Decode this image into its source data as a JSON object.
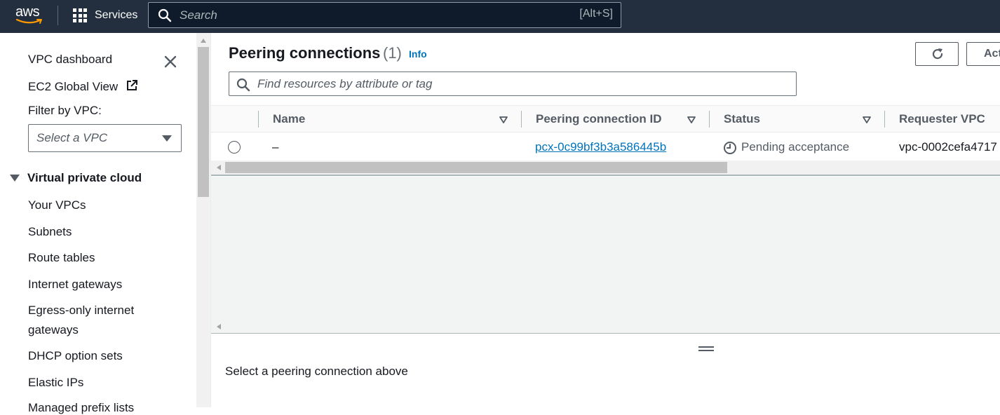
{
  "topnav": {
    "logo_text": "aws",
    "services_label": "Services",
    "search_placeholder": "Search",
    "search_shortcut": "[Alt+S]"
  },
  "sidebar": {
    "dashboard": "VPC dashboard",
    "ec2_global_view": "EC2 Global View",
    "filter_label": "Filter by VPC:",
    "vpc_select_placeholder": "Select a VPC",
    "section_title": "Virtual private cloud",
    "items": [
      "Your VPCs",
      "Subnets",
      "Route tables",
      "Internet gateways",
      "Egress-only internet",
      "gateways",
      "DHCP option sets",
      "Elastic IPs",
      "Managed prefix lists"
    ]
  },
  "main": {
    "title": "Peering connections",
    "count": "(1)",
    "info_label": "Info",
    "actions_label": "Act",
    "filter_placeholder": "Find resources by attribute or tag",
    "columns": [
      "Name",
      "Peering connection ID",
      "Status",
      "Requester VPC"
    ],
    "rows": [
      {
        "name": "–",
        "peering_id": "pcx-0c99bf3b3a586445b",
        "status": "Pending acceptance",
        "requester_vpc": "vpc-0002cefa4717"
      }
    ],
    "split_panel_message": "Select a peering connection above"
  }
}
